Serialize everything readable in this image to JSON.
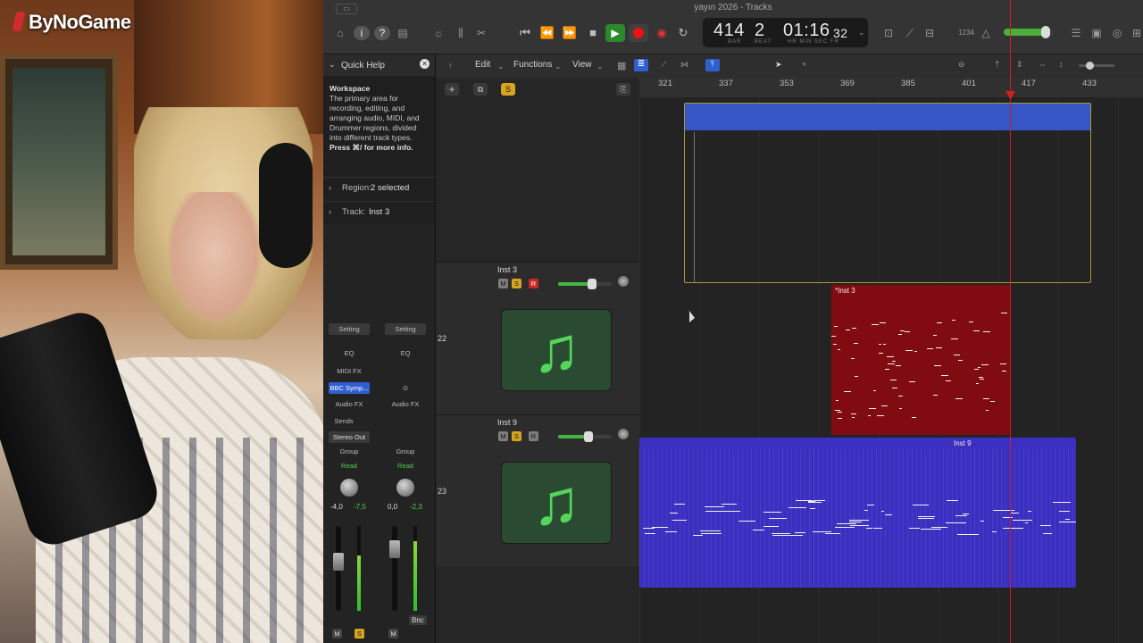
{
  "overlay": {
    "brand": "ByNoGame"
  },
  "window": {
    "title": "yayın 2026 - Tracks"
  },
  "lcd": {
    "bar": "414",
    "beat": "2",
    "bar_label": "BAR",
    "beat_label": "BEAT",
    "time_main": "01:16",
    "time_sub": "32",
    "time_labels": "HR MIN SEC FR"
  },
  "toolbar": {
    "meter_readout": "1234"
  },
  "quickhelp": {
    "title": "Quick Help",
    "heading": "Workspace",
    "body": "The primary area for recording, editing, and arranging audio, MIDI, and Drummer regions, divided into different track types.",
    "more": "Press ⌘/ for more info.",
    "region_label": "Region:",
    "region_value": "2 selected",
    "track_label": "Track:",
    "track_value": "Inst 3"
  },
  "channel_strips": {
    "setting": "Setting",
    "eq": "EQ",
    "midi_fx": "MIDI FX",
    "instrument": "BBC Symp...",
    "audio_fx": "Audio FX",
    "sends": "Sends",
    "output": "Stereo Out",
    "group": "Group",
    "automation": "Read",
    "left_pan": "-4,0",
    "left_peak": "-7,5",
    "right_pan": "0,0",
    "right_peak": "-2,3",
    "bounce": "Bnc",
    "mute": "M",
    "solo": "S"
  },
  "editbar": {
    "menus": [
      "Edit",
      "Functions",
      "View"
    ]
  },
  "ruler": {
    "bars": [
      "321",
      "337",
      "353",
      "369",
      "385",
      "401",
      "417",
      "433"
    ]
  },
  "tracks": [
    {
      "number": "22",
      "name": "Inst 3",
      "region_name": "*Inst 3",
      "mute": "M",
      "solo": "S",
      "rec": "R",
      "volume": 0.62
    },
    {
      "number": "23",
      "name": "Inst 9",
      "region_name": "Inst 9",
      "mute": "M",
      "solo": "S",
      "rec": "R",
      "volume": 0.55
    }
  ],
  "colors": {
    "inst3_region": "#800c12",
    "inst9_region": "#3a2fc0",
    "top_region": "#3556c4",
    "playhead": "#d01f1f",
    "play": "#2a8a2a",
    "record": "#e11111"
  }
}
